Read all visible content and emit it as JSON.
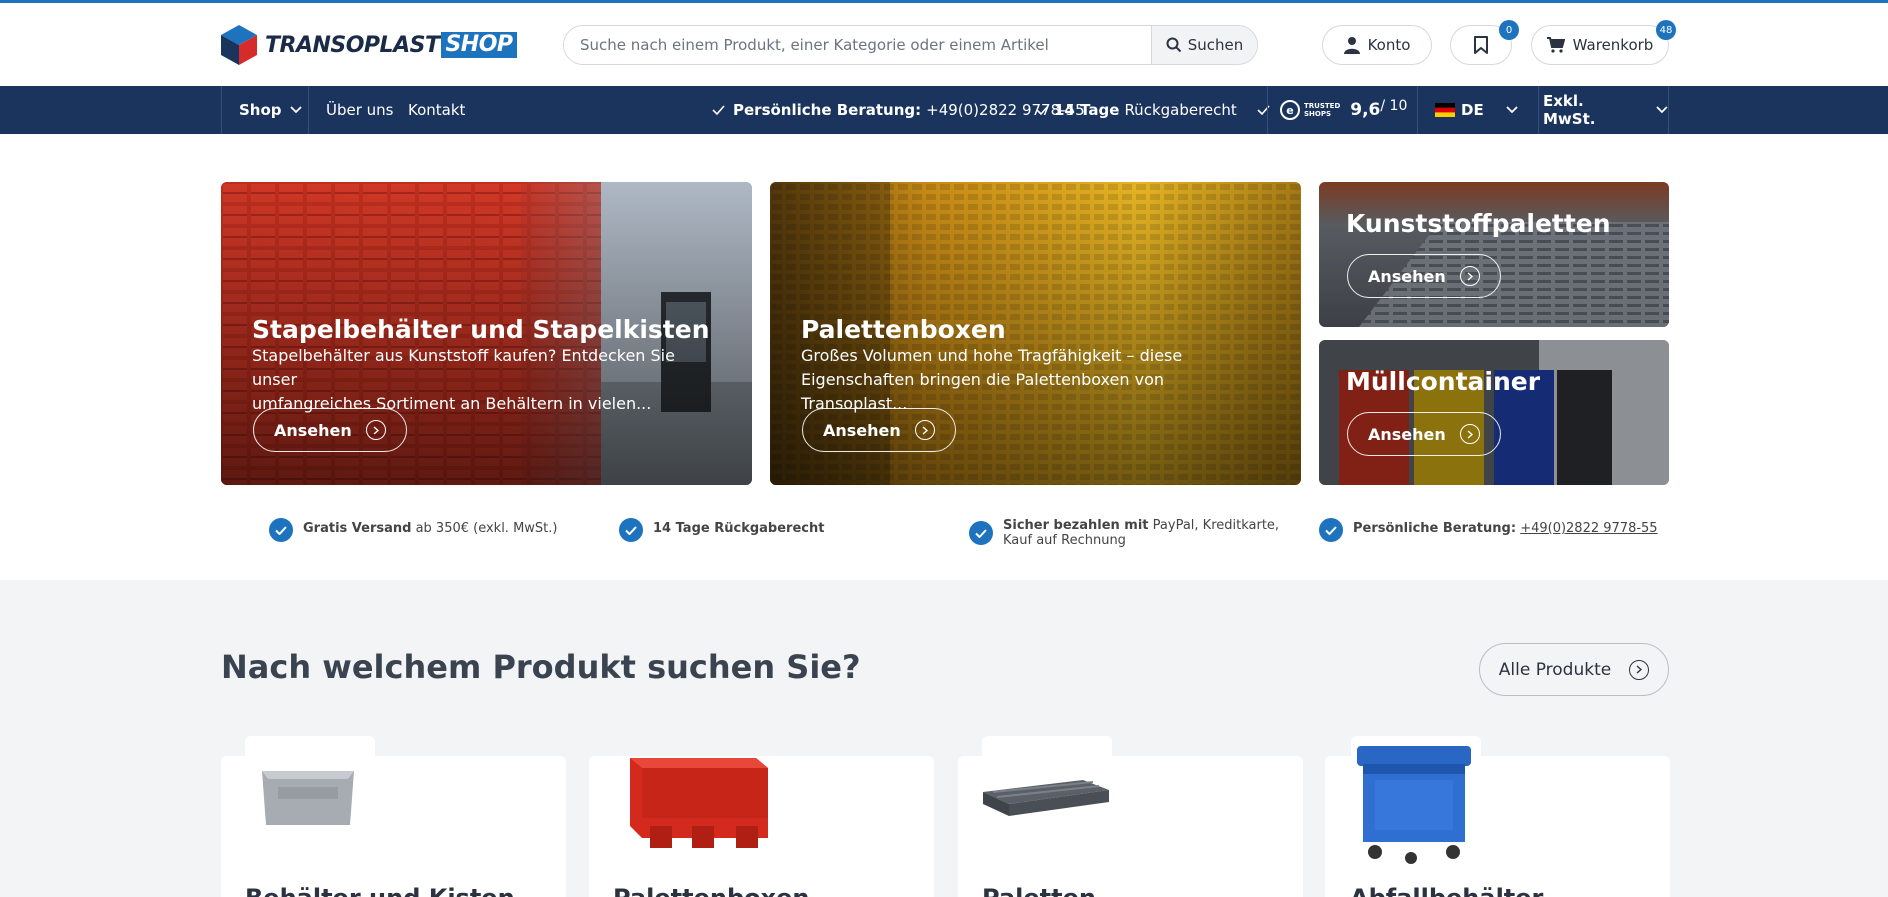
{
  "header": {
    "logo_main": "TRANSOPLAST",
    "logo_shop": "SHOP",
    "search_placeholder": "Suche nach einem Produkt, einer Kategorie oder einem Artikel",
    "search_button": "Suchen",
    "account_label": "Konto",
    "wishlist_count": "0",
    "cart_label": "Warenkorb",
    "cart_count": "48"
  },
  "nav": {
    "shop": "Shop",
    "about": "Über uns",
    "contact": "Kontakt",
    "consult_label": "Persönliche Beratung:",
    "consult_phone": "+49(0)2822 9778-55",
    "return_bold": "14 Tage",
    "return_rest": "Rückgaberecht",
    "trusted_line1": "TRUSTED",
    "trusted_line2": "SHOPS",
    "rating": "9,6",
    "rating_max": "/ 10",
    "language": "DE",
    "tax": "Exkl. MwSt."
  },
  "tiles": [
    {
      "title": "Stapelbehälter und Stapelkisten",
      "desc1": "Stapelbehälter aus Kunststoff kaufen? Entdecken Sie unser",
      "desc2": "umfangreiches Sortiment an Behältern in vielen...",
      "button": "Ansehen"
    },
    {
      "title": "Palettenboxen",
      "desc1": "Großes Volumen und hohe Tragfähigkeit – diese",
      "desc2": "Eigenschaften bringen die Palettenboxen von Transoplast...",
      "button": "Ansehen"
    },
    {
      "title": "Kunststoffpaletten",
      "button": "Ansehen"
    },
    {
      "title": "Müllcontainer",
      "button": "Ansehen"
    }
  ],
  "usps": [
    {
      "bold": "Gratis Versand",
      "rest": " ab 350€ (exkl. MwSt.)"
    },
    {
      "bold": "14 Tage Rückgaberecht",
      "rest": ""
    },
    {
      "bold": "Sicher bezahlen mit",
      "rest": " PayPal, Kreditkarte,",
      "rest2": "Kauf auf Rechnung"
    },
    {
      "bold": "Persönliche Beratung:",
      "link": "+49(0)2822 9778-55"
    }
  ],
  "products_section": {
    "title": "Nach welchem Produkt suchen Sie?",
    "all_button": "Alle Produkte",
    "cards": [
      {
        "label": "Behälter und Kisten"
      },
      {
        "label": "Palettenboxen"
      },
      {
        "label": "Paletten"
      },
      {
        "label": "Abfallbehälter"
      }
    ]
  },
  "colors": {
    "accent": "#1e73be",
    "nav_bg": "#1a345d",
    "section_bg": "#f3f4f6"
  }
}
